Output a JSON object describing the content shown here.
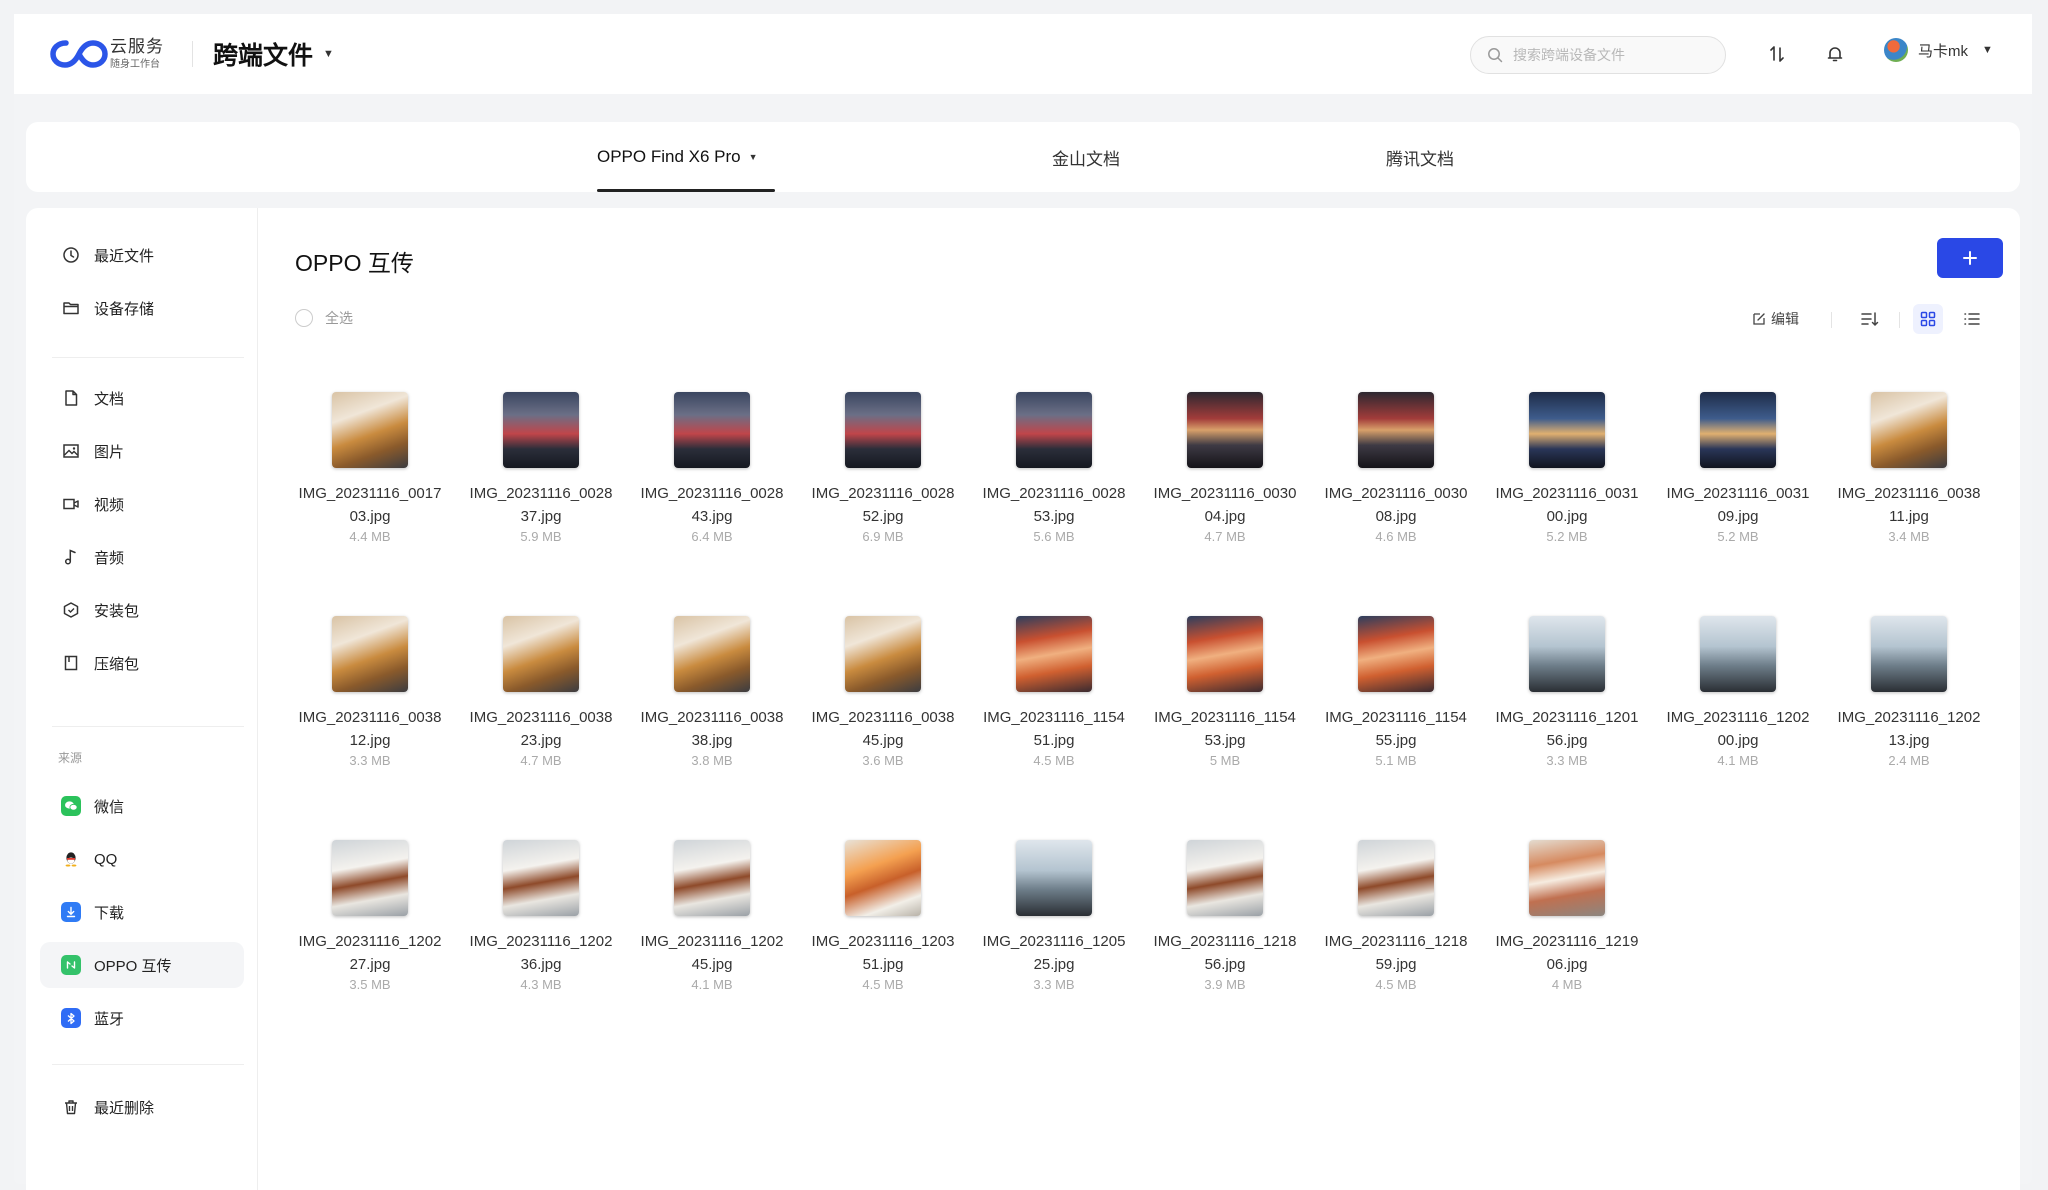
{
  "header": {
    "logo_main": "云服务",
    "logo_sub": "随身工作台",
    "app_title": "跨端文件",
    "search_placeholder": "搜索跨端设备文件",
    "user_name": "马卡mk"
  },
  "device_tabs": [
    {
      "label": "OPPO Find X6 Pro",
      "active": true
    },
    {
      "label": "金山文档",
      "active": false
    },
    {
      "label": "腾讯文档",
      "active": false
    }
  ],
  "sidebar": {
    "items": [
      {
        "label": "最近文件",
        "icon": "clock-icon"
      },
      {
        "label": "设备存储",
        "icon": "folder-icon"
      },
      {
        "label": "文档",
        "icon": "document-icon"
      },
      {
        "label": "图片",
        "icon": "image-icon"
      },
      {
        "label": "视频",
        "icon": "video-icon"
      },
      {
        "label": "音频",
        "icon": "music-note-icon"
      },
      {
        "label": "安装包",
        "icon": "package-icon"
      },
      {
        "label": "压缩包",
        "icon": "archive-icon"
      }
    ],
    "section_label": "来源",
    "sources": [
      {
        "label": "微信",
        "icon": "wechat-icon",
        "color": "#2bc25b"
      },
      {
        "label": "QQ",
        "icon": "qq-icon",
        "color": "#222222"
      },
      {
        "label": "下载",
        "icon": "download-icon",
        "color": "#2f7bf5"
      },
      {
        "label": "OPPO 互传",
        "icon": "oppo-share-icon",
        "color": "#34c26a",
        "active": true
      },
      {
        "label": "蓝牙",
        "icon": "bluetooth-icon",
        "color": "#2f6cf5"
      }
    ],
    "trash_label": "最近删除"
  },
  "main": {
    "folder_title": "OPPO 互传",
    "select_all": "全选",
    "edit_label": "编辑",
    "accent_color": "#2a48e6"
  },
  "files": [
    {
      "name": "IMG_20231116_001703.jpg",
      "size": "4.4 MB",
      "thumb": "food"
    },
    {
      "name": "IMG_20231116_002837.jpg",
      "size": "5.9 MB",
      "thumb": "street"
    },
    {
      "name": "IMG_20231116_002843.jpg",
      "size": "6.4 MB",
      "thumb": "street"
    },
    {
      "name": "IMG_20231116_002852.jpg",
      "size": "6.9 MB",
      "thumb": "street"
    },
    {
      "name": "IMG_20231116_002853.jpg",
      "size": "5.6 MB",
      "thumb": "street"
    },
    {
      "name": "IMG_20231116_003004.jpg",
      "size": "4.7 MB",
      "thumb": "night"
    },
    {
      "name": "IMG_20231116_003008.jpg",
      "size": "4.6 MB",
      "thumb": "night"
    },
    {
      "name": "IMG_20231116_003100.jpg",
      "size": "5.2 MB",
      "thumb": "nightblue"
    },
    {
      "name": "IMG_20231116_003109.jpg",
      "size": "5.2 MB",
      "thumb": "nightblue"
    },
    {
      "name": "IMG_20231116_003811.jpg",
      "size": "3.4 MB",
      "thumb": "food"
    },
    {
      "name": "IMG_20231116_003812.jpg",
      "size": "3.3 MB",
      "thumb": "food"
    },
    {
      "name": "IMG_20231116_003823.jpg",
      "size": "4.7 MB",
      "thumb": "food"
    },
    {
      "name": "IMG_20231116_003838.jpg",
      "size": "3.8 MB",
      "thumb": "food"
    },
    {
      "name": "IMG_20231116_003845.jpg",
      "size": "3.6 MB",
      "thumb": "food"
    },
    {
      "name": "IMG_20231116_115451.jpg",
      "size": "4.5 MB",
      "thumb": "seafood"
    },
    {
      "name": "IMG_20231116_115453.jpg",
      "size": "5 MB",
      "thumb": "seafood"
    },
    {
      "name": "IMG_20231116_115455.jpg",
      "size": "5.1 MB",
      "thumb": "seafood"
    },
    {
      "name": "IMG_20231116_120156.jpg",
      "size": "3.3 MB",
      "thumb": "window"
    },
    {
      "name": "IMG_20231116_120200.jpg",
      "size": "4.1 MB",
      "thumb": "window"
    },
    {
      "name": "IMG_20231116_120213.jpg",
      "size": "2.4 MB",
      "thumb": "window"
    },
    {
      "name": "IMG_20231116_120227.jpg",
      "size": "3.5 MB",
      "thumb": "plate"
    },
    {
      "name": "IMG_20231116_120236.jpg",
      "size": "4.3 MB",
      "thumb": "plate"
    },
    {
      "name": "IMG_20231116_120245.jpg",
      "size": "4.1 MB",
      "thumb": "plate"
    },
    {
      "name": "IMG_20231116_120351.jpg",
      "size": "4.5 MB",
      "thumb": "drinks"
    },
    {
      "name": "IMG_20231116_120525.jpg",
      "size": "3.3 MB",
      "thumb": "window"
    },
    {
      "name": "IMG_20231116_121856.jpg",
      "size": "3.9 MB",
      "thumb": "plate"
    },
    {
      "name": "IMG_20231116_121859.jpg",
      "size": "4.5 MB",
      "thumb": "plate"
    },
    {
      "name": "IMG_20231116_121906.jpg",
      "size": "4 MB",
      "thumb": "oysters"
    }
  ]
}
